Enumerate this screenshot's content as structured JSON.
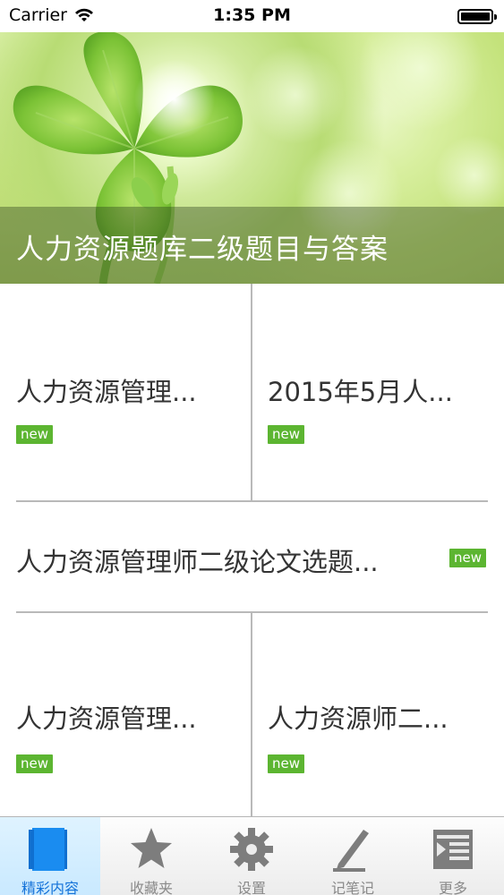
{
  "status_bar": {
    "carrier": "Carrier",
    "time": "1:35 PM",
    "battery_level": 1.0
  },
  "banner": {
    "title": "人力资源题库二级题目与答案"
  },
  "items": [
    {
      "title": "人力资源管理...",
      "badge": "new"
    },
    {
      "title": "2015年5月人...",
      "badge": "new"
    },
    {
      "title": "人力资源管理师二级论文选题...",
      "badge": "new"
    },
    {
      "title": "人力资源管理...",
      "badge": "new"
    },
    {
      "title": "人力资源师二...",
      "badge": "new"
    }
  ],
  "tab_bar": {
    "tabs": [
      {
        "label": "精彩内容",
        "icon": "book-icon",
        "active": true
      },
      {
        "label": "收藏夹",
        "icon": "star-icon",
        "active": false
      },
      {
        "label": "设置",
        "icon": "gear-icon",
        "active": false
      },
      {
        "label": "记笔记",
        "icon": "pen-icon",
        "active": false
      },
      {
        "label": "更多",
        "icon": "more-list-icon",
        "active": false
      }
    ]
  },
  "colors": {
    "badge": "#5cb531",
    "active_tab": "#1472d8",
    "divider": "#b9b9b9"
  }
}
